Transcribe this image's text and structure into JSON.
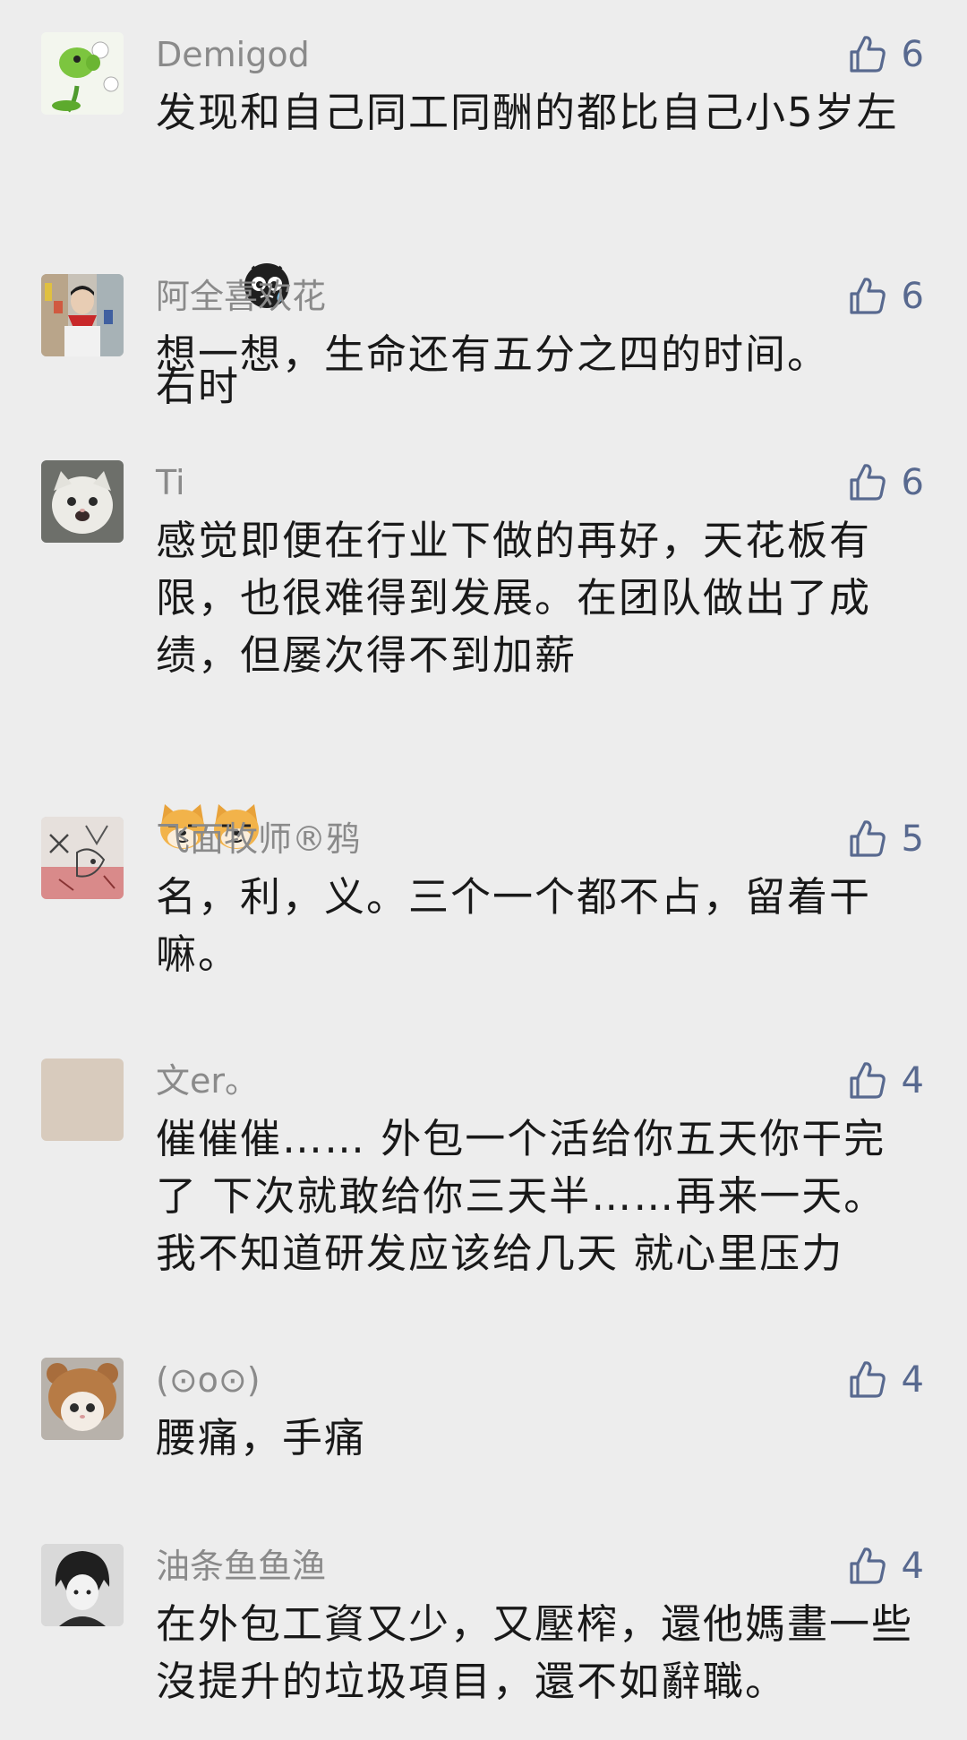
{
  "comments": [
    {
      "avatar_icon": "peashooter-avatar-icon",
      "username": "Demigod",
      "likes": "6",
      "text": "发现和自己同工同酬的都比自己小5岁左右时",
      "emoji": [
        "crying-face-emoji"
      ]
    },
    {
      "avatar_icon": "person-red-scarf-avatar-icon",
      "username": "阿全喜欢花",
      "likes": "6",
      "text": "想一想，生命还有五分之四的时间。"
    },
    {
      "avatar_icon": "white-cat-avatar-icon",
      "username": "Ti",
      "likes": "6",
      "text": "感觉即便在行业下做的再好，天花板有限，也很难得到发展。在团队做出了成绩，但屡次得不到加薪",
      "emoji": [
        "doge-emoji",
        "doge-emoji"
      ]
    },
    {
      "avatar_icon": "sketch-drawing-avatar-icon",
      "username": "飞面牧师®鸦",
      "likes": "5",
      "text": "名，利，义。三个一个都不占，留着干嘛。"
    },
    {
      "avatar_icon": "blank-beige-avatar-icon",
      "username": "文er。",
      "likes": "4",
      "text": "催催催…… 外包一个活给你五天你干完了 下次就敢给你三天半……再来一天。我不知道研发应该给几天 就心里压力"
    },
    {
      "avatar_icon": "cat-bear-hat-avatar-icon",
      "username": "(⊙o⊙)",
      "likes": "4",
      "text": "腰痛，手痛"
    },
    {
      "avatar_icon": "anime-boy-avatar-icon",
      "username": "油条鱼鱼渔",
      "likes": "4",
      "text": "在外包工資又少，又壓榨，還他媽畫一些沒提升的垃圾項目，還不如辭職。"
    }
  ],
  "colors": {
    "background": "#ededed",
    "username": "#8a8a8a",
    "like_accent": "#58698f",
    "text": "#191919"
  }
}
